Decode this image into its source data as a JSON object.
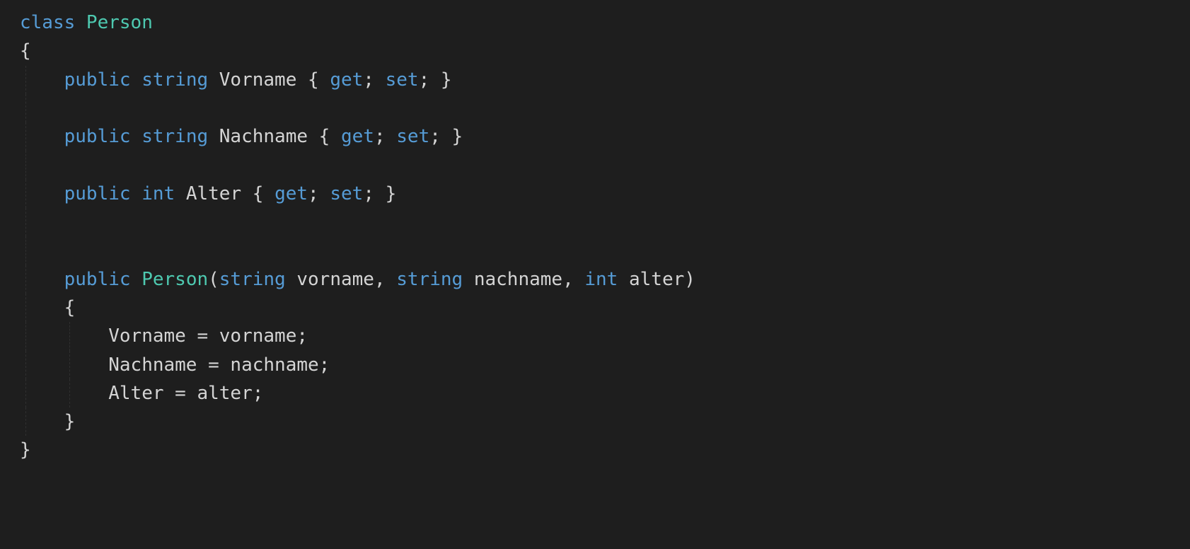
{
  "code": {
    "lines": [
      {
        "indent": 0,
        "tokens": [
          {
            "t": "class ",
            "c": "kw"
          },
          {
            "t": "Person",
            "c": "type"
          }
        ]
      },
      {
        "indent": 0,
        "tokens": [
          {
            "t": "{",
            "c": "punct"
          }
        ]
      },
      {
        "indent": 1,
        "tokens": [
          {
            "t": "public ",
            "c": "kw"
          },
          {
            "t": "string ",
            "c": "kw"
          },
          {
            "t": "Vorname ",
            "c": "prop"
          },
          {
            "t": "{ ",
            "c": "punct"
          },
          {
            "t": "get",
            "c": "kw"
          },
          {
            "t": "; ",
            "c": "punct"
          },
          {
            "t": "set",
            "c": "kw"
          },
          {
            "t": "; }",
            "c": "punct"
          }
        ]
      },
      {
        "indent": 1,
        "tokens": []
      },
      {
        "indent": 1,
        "tokens": [
          {
            "t": "public ",
            "c": "kw"
          },
          {
            "t": "string ",
            "c": "kw"
          },
          {
            "t": "Nachname ",
            "c": "prop"
          },
          {
            "t": "{ ",
            "c": "punct"
          },
          {
            "t": "get",
            "c": "kw"
          },
          {
            "t": "; ",
            "c": "punct"
          },
          {
            "t": "set",
            "c": "kw"
          },
          {
            "t": "; }",
            "c": "punct"
          }
        ]
      },
      {
        "indent": 1,
        "tokens": []
      },
      {
        "indent": 1,
        "tokens": [
          {
            "t": "public ",
            "c": "kw"
          },
          {
            "t": "int ",
            "c": "kw"
          },
          {
            "t": "Alter ",
            "c": "prop"
          },
          {
            "t": "{ ",
            "c": "punct"
          },
          {
            "t": "get",
            "c": "kw"
          },
          {
            "t": "; ",
            "c": "punct"
          },
          {
            "t": "set",
            "c": "kw"
          },
          {
            "t": "; }",
            "c": "punct"
          }
        ]
      },
      {
        "indent": 1,
        "tokens": []
      },
      {
        "indent": 1,
        "tokens": []
      },
      {
        "indent": 1,
        "tokens": [
          {
            "t": "public ",
            "c": "kw"
          },
          {
            "t": "Person",
            "c": "func"
          },
          {
            "t": "(",
            "c": "punct"
          },
          {
            "t": "string ",
            "c": "kw"
          },
          {
            "t": "vorname",
            "c": "param"
          },
          {
            "t": ", ",
            "c": "punct"
          },
          {
            "t": "string ",
            "c": "kw"
          },
          {
            "t": "nachname",
            "c": "param"
          },
          {
            "t": ", ",
            "c": "punct"
          },
          {
            "t": "int ",
            "c": "kw"
          },
          {
            "t": "alter",
            "c": "param"
          },
          {
            "t": ")",
            "c": "punct"
          }
        ]
      },
      {
        "indent": 1,
        "tokens": [
          {
            "t": "{",
            "c": "punct"
          }
        ]
      },
      {
        "indent": 2,
        "tokens": [
          {
            "t": "Vorname = vorname;",
            "c": "ident"
          }
        ]
      },
      {
        "indent": 2,
        "tokens": [
          {
            "t": "Nachname = nachname;",
            "c": "ident"
          }
        ]
      },
      {
        "indent": 2,
        "tokens": [
          {
            "t": "Alter = alter;",
            "c": "ident"
          }
        ]
      },
      {
        "indent": 1,
        "tokens": [
          {
            "t": "}",
            "c": "punct"
          }
        ]
      },
      {
        "indent": 0,
        "tokens": [
          {
            "t": "}",
            "c": "punct"
          }
        ]
      }
    ],
    "indentUnit": "    "
  }
}
